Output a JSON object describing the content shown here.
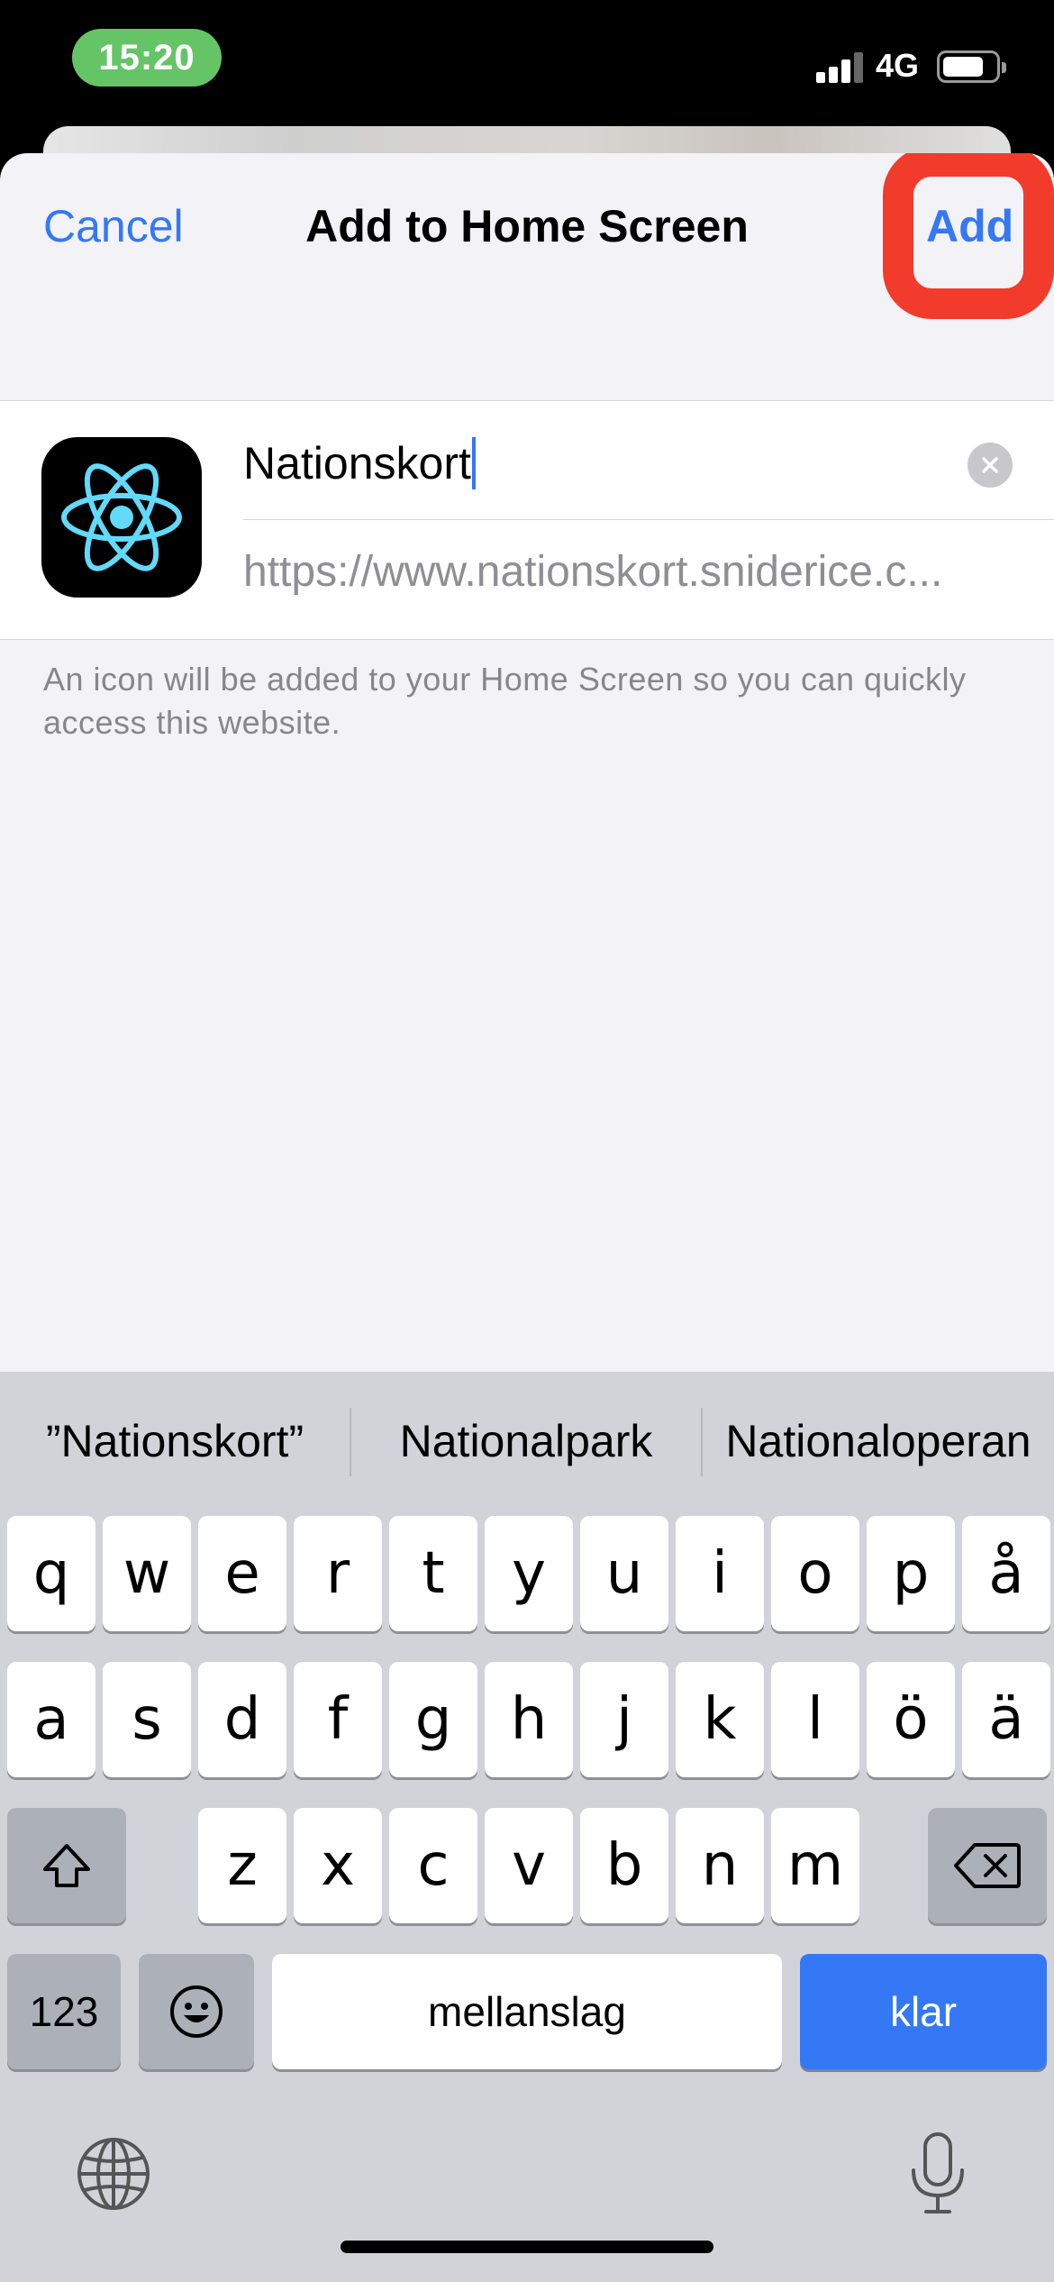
{
  "status_bar": {
    "time": "15:20",
    "network": "4G",
    "time_pill_color": "#65c466",
    "signal_bars_active": 3,
    "signal_bars_total": 4,
    "battery_level": 0.8
  },
  "sheet": {
    "title": "Add to Home Screen",
    "cancel_label": "Cancel",
    "add_label": "Add",
    "accent_color": "#3478f6",
    "highlight_color": "#f23b2b"
  },
  "form": {
    "app_icon": "react-atom-icon",
    "name_value": "Nationskort",
    "url_value": "https://www.nationskort.sniderice.c...",
    "clear_icon": "clear-circle-icon"
  },
  "hint_text": "An icon will be added to your Home Screen so you can quickly access this website.",
  "keyboard": {
    "suggestions": [
      "”Nationskort”",
      "Nationalpark",
      "Nationaloperan"
    ],
    "row1": [
      "q",
      "w",
      "e",
      "r",
      "t",
      "y",
      "u",
      "i",
      "o",
      "p",
      "å"
    ],
    "row2": [
      "a",
      "s",
      "d",
      "f",
      "g",
      "h",
      "j",
      "k",
      "l",
      "ö",
      "ä"
    ],
    "row3": [
      "z",
      "x",
      "c",
      "v",
      "b",
      "n",
      "m"
    ],
    "numbers_label": "123",
    "space_label": "mellanslag",
    "return_label": "klar",
    "shift_icon": "shift-icon",
    "backspace_icon": "backspace-icon",
    "emoji_icon": "emoji-icon",
    "globe_icon": "globe-icon",
    "mic_icon": "microphone-icon"
  }
}
